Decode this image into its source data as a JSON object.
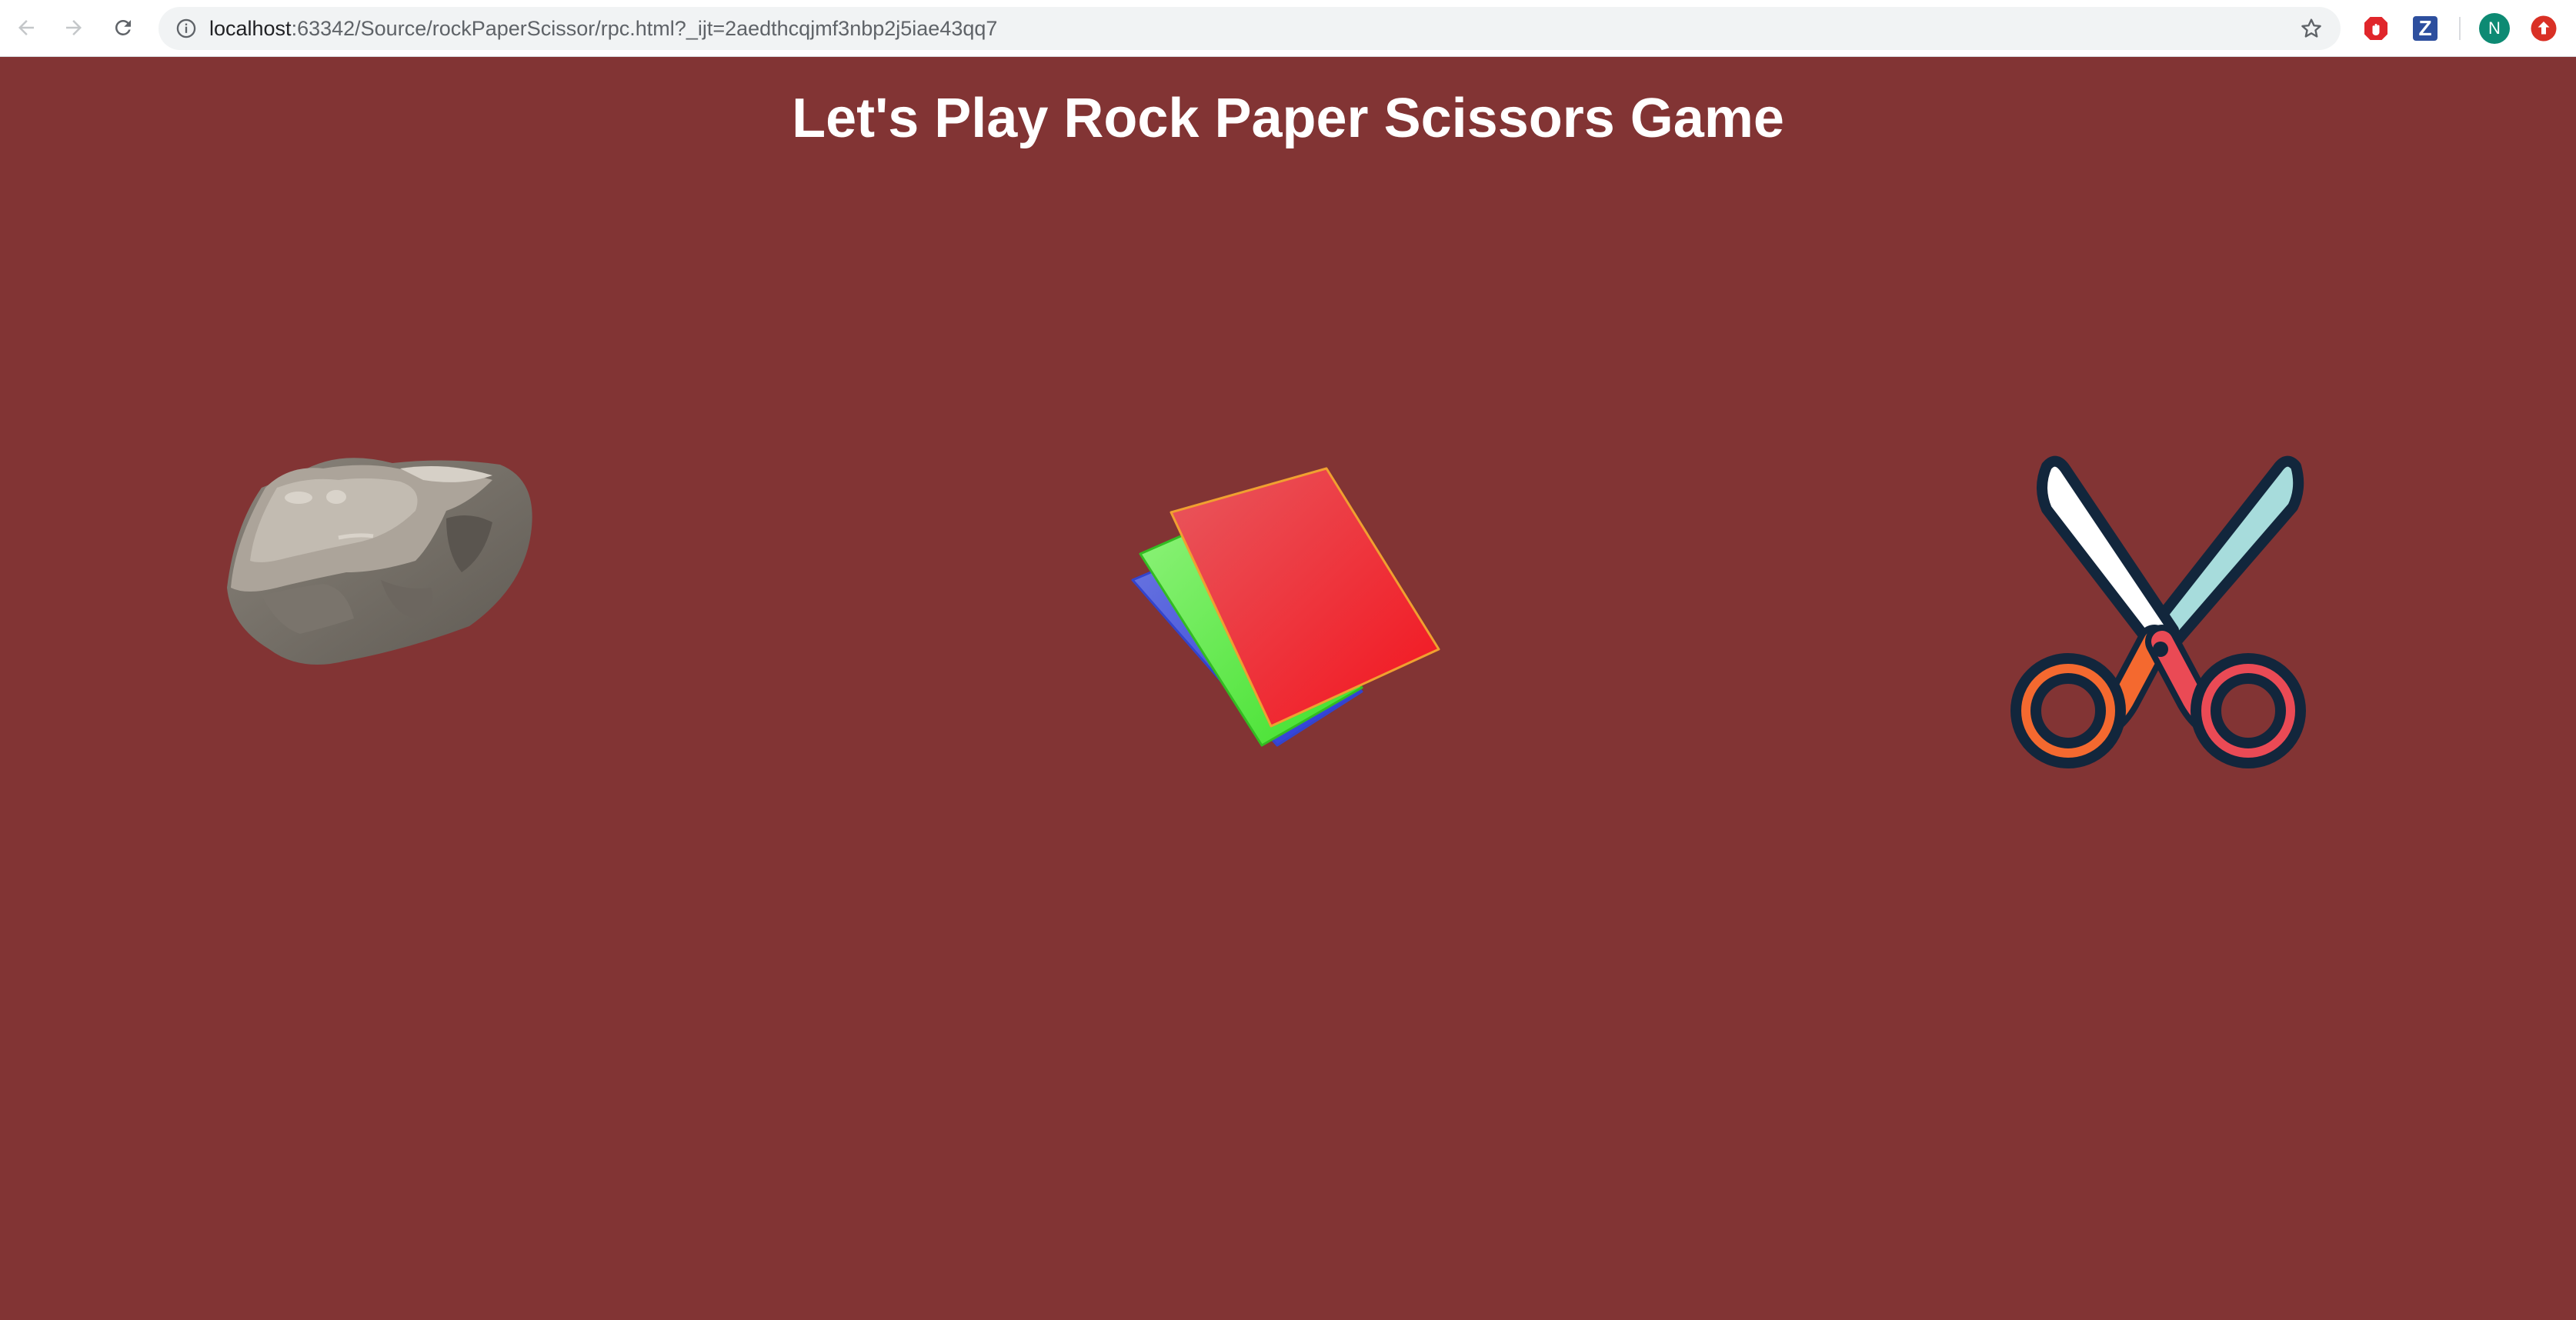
{
  "browser": {
    "url_host": "localhost",
    "url_path": ":63342/Source/rockPaperScissor/rpc.html?_ijt=2aedthcqjmf3nbp2j5iae43qq7",
    "icons": {
      "back": "arrow-left-icon",
      "forward": "arrow-right-icon",
      "reload": "reload-icon",
      "info": "info-icon",
      "bookmark": "star-icon"
    },
    "extensions": [
      "adblock-icon",
      "zotero-icon",
      "profile-avatar",
      "update-icon"
    ],
    "avatar_letter": "N",
    "z_letter": "Z"
  },
  "game": {
    "title": "Let's Play Rock Paper Scissors Game",
    "choices": [
      {
        "name": "rock",
        "icon": "rock-icon"
      },
      {
        "name": "paper",
        "icon": "paper-icon"
      },
      {
        "name": "scissors",
        "icon": "scissors-icon"
      }
    ]
  },
  "colors": {
    "page_background": "#823434",
    "title_text": "#ffffff"
  }
}
